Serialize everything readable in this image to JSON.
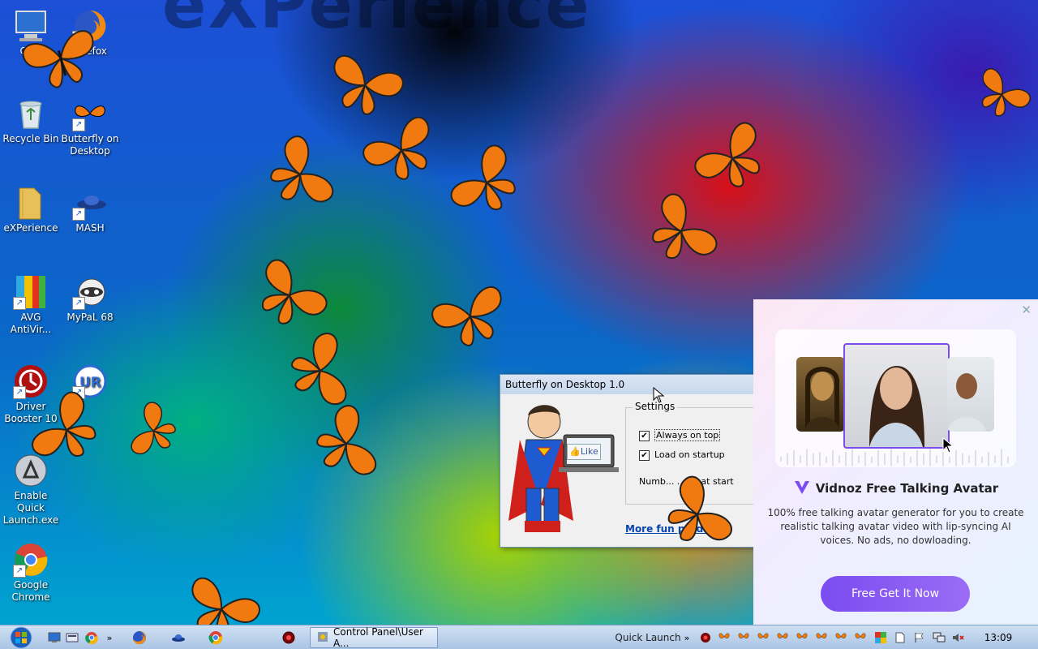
{
  "wallpaper_text": "eXPerience",
  "desktop_icons": [
    {
      "name": "computer",
      "label": "Co..."
    },
    {
      "name": "firefox",
      "label": "...refox"
    },
    {
      "name": "recycle-bin",
      "label": "Recycle Bin"
    },
    {
      "name": "butterfly-on-desktop",
      "label": "Butterfly on Desktop"
    },
    {
      "name": "experience",
      "label": "eXPerience"
    },
    {
      "name": "mash",
      "label": "MASH"
    },
    {
      "name": "avg",
      "label": "AVG AntiVir..."
    },
    {
      "name": "mypal",
      "label": "MyPaL 68"
    },
    {
      "name": "driver-booster",
      "label": "Driver Booster 10"
    },
    {
      "name": "ur-browser",
      "label": ""
    },
    {
      "name": "enable-quick-launch",
      "label": "Enable Quick Launch.exe"
    },
    {
      "name": "google-chrome",
      "label": "Google Chrome"
    }
  ],
  "dialog": {
    "title": "Butterfly on Desktop 1.0",
    "like_label": "Like",
    "settings_label": "Settings",
    "always_on_top": "Always on top",
    "load_on_startup": "Load on startup",
    "number_label": "Numb... ...ies at start",
    "more_link": "More fun prod..."
  },
  "popup": {
    "title": "Vidnoz Free Talking Avatar",
    "description": "100% free talking avatar generator for you to create realistic talking avatar video with lip-syncing AI voices. No ads, no dowloading.",
    "cta": "Free Get It Now"
  },
  "taskbar": {
    "active_window": "Control Panel\\User A...",
    "quick_launch": "Quick Launch",
    "clock": "13:09"
  },
  "colors": {
    "accent": "#7b4cf0",
    "butterfly": "#f07a10",
    "taskbar": "#bcd2ec"
  }
}
